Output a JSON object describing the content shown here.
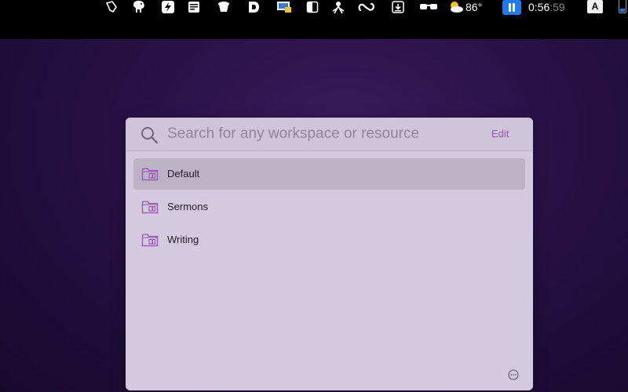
{
  "menubar": {
    "icons": [
      "cursor-hand-icon",
      "elephant-icon",
      "lightning-icon",
      "notes-icon",
      "bowl-icon",
      "d-letter-icon",
      "display-icon",
      "sidebar-toggle-icon",
      "spider-icon",
      "infinity-icon",
      "download-box-icon",
      "glasses-icon",
      "weather-partly-sunny-icon"
    ],
    "temperature": "86°",
    "clock_main": "0:56",
    "clock_seconds": ":59",
    "input_source": "A"
  },
  "panel": {
    "search": {
      "placeholder": "Search for any workspace or resource",
      "value": ""
    },
    "edit_label": "Edit",
    "items": [
      {
        "label": "Default",
        "selected": true
      },
      {
        "label": "Sermons",
        "selected": false
      },
      {
        "label": "Writing",
        "selected": false
      }
    ],
    "accent_color": "#9a55b7"
  }
}
